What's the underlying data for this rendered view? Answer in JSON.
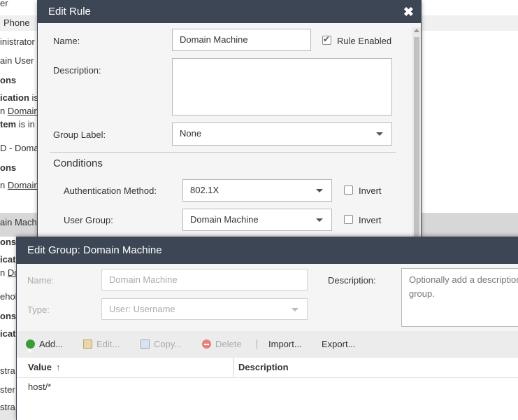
{
  "background_list": {
    "rows": [
      {
        "text": "er",
        "bold": false
      },
      {
        "text": "Phone",
        "bold": false
      },
      {
        "text": "inistrator",
        "bold": false
      },
      {
        "text": "ain User",
        "bold": false
      },
      {
        "text": "ons",
        "bold": true
      },
      {
        "text_bold": "ication",
        "text_rest": " is"
      },
      {
        "text_plain": "n ",
        "text_link": "Domain"
      },
      {
        "text_bold": "tem",
        "text_rest": " is in"
      },
      {
        "text": "D - Doma",
        "bold": false
      },
      {
        "text": "ons",
        "bold": true
      },
      {
        "text_plain": "n ",
        "text_link": "Domain"
      },
      {
        "text": "ain Mach",
        "bold": false
      },
      {
        "text": "ons",
        "bold": true
      },
      {
        "text": "icat",
        "bold": true
      },
      {
        "text_plain": "n ",
        "text_link": "Do"
      },
      {
        "text": "ehol",
        "bold": false
      },
      {
        "text": "ons",
        "bold": true
      },
      {
        "text": "icat",
        "bold": true
      },
      {
        "text": "stra",
        "bold": false
      },
      {
        "text": "ster",
        "bold": false
      },
      {
        "text": "stra",
        "bold": false
      }
    ]
  },
  "edit_rule": {
    "title": "Edit Rule",
    "close_label": "✖",
    "name_label": "Name:",
    "name_value": "Domain Machine",
    "rule_enabled_label": "Rule Enabled",
    "rule_enabled": true,
    "description_label": "Description:",
    "description_value": "",
    "group_label_label": "Group Label:",
    "group_label_value": "None",
    "conditions_title": "Conditions",
    "auth_method_label": "Authentication Method:",
    "auth_method_value": "802.1X",
    "auth_invert_label": "Invert",
    "auth_invert": false,
    "user_group_label": "User Group:",
    "user_group_value": "Domain Machine",
    "user_group_invert_label": "Invert",
    "user_group_invert": false
  },
  "edit_group": {
    "title": "Edit Group: Domain Machine",
    "name_label": "Name:",
    "name_value": "Domain Machine",
    "type_label": "Type:",
    "type_value": "User: Username",
    "description_label": "Description:",
    "description_placeholder": "Optionally add a description\ngroup.",
    "toolbar": {
      "add": "Add...",
      "edit": "Edit...",
      "copy": "Copy...",
      "delete": "Delete",
      "import": "Import...",
      "export": "Export..."
    },
    "columns": {
      "value": "Value",
      "sort_indicator": "↑",
      "description": "Description"
    },
    "rows": [
      {
        "value": "host/*",
        "description": ""
      }
    ]
  },
  "colors": {
    "header_bg": "#3d4654",
    "dialog_bg": "#f5f5f5",
    "add_icon": "#3a9b3a",
    "delete_icon": "#e8807a"
  }
}
